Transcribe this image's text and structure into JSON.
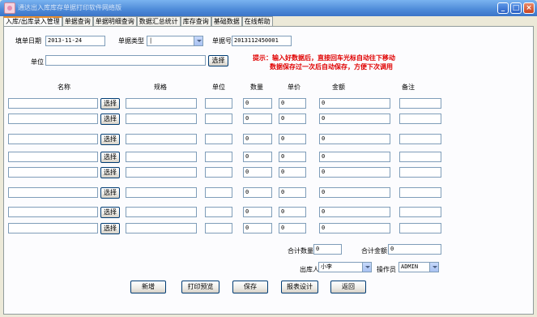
{
  "window": {
    "title": "通达出入库库存单据打印软件网络版"
  },
  "tabs": [
    "入库/出库录入管理",
    "单据查询",
    "单据明细查询",
    "数据汇总统计",
    "库存查询",
    "基础数据",
    "在线帮助"
  ],
  "form": {
    "date_label": "填单日期",
    "date_value": "2013-11-24",
    "type_label": "单据类型",
    "type_value": "|",
    "number_label": "单据号",
    "number_value": "2013112450001",
    "unit_label": "单位",
    "unit_value": "",
    "select_label": "选择"
  },
  "hint": {
    "line1": "提示：输入好数据后，直接回车光标自动往下移动",
    "line2": "数据保存过一次后自动保存，方便下次调用"
  },
  "columns": {
    "name": "名称",
    "spec": "规格",
    "unit": "单位",
    "qty": "数量",
    "price": "单价",
    "amount": "金额",
    "note": "备注"
  },
  "rows": [
    {
      "qty": "0",
      "price": "0",
      "amount": "0"
    },
    {
      "qty": "0",
      "price": "0",
      "amount": "0"
    },
    {
      "qty": "0",
      "price": "0",
      "amount": "0"
    },
    {
      "qty": "0",
      "price": "0",
      "amount": "0"
    },
    {
      "qty": "0",
      "price": "0",
      "amount": "0"
    },
    {
      "qty": "0",
      "price": "0",
      "amount": "0"
    },
    {
      "qty": "0",
      "price": "0",
      "amount": "0"
    },
    {
      "qty": "0",
      "price": "0",
      "amount": "0"
    }
  ],
  "totals": {
    "qty_label": "合计数量",
    "qty_value": "0",
    "amount_label": "合计金额",
    "amount_value": "0"
  },
  "staff": {
    "out_label": "出库人",
    "out_value": "小李",
    "op_label": "操作员",
    "op_value": "ADMIN"
  },
  "actions": {
    "new": "新增",
    "print": "打印预览",
    "save": "保存",
    "design": "报表设计",
    "back": "返回"
  }
}
